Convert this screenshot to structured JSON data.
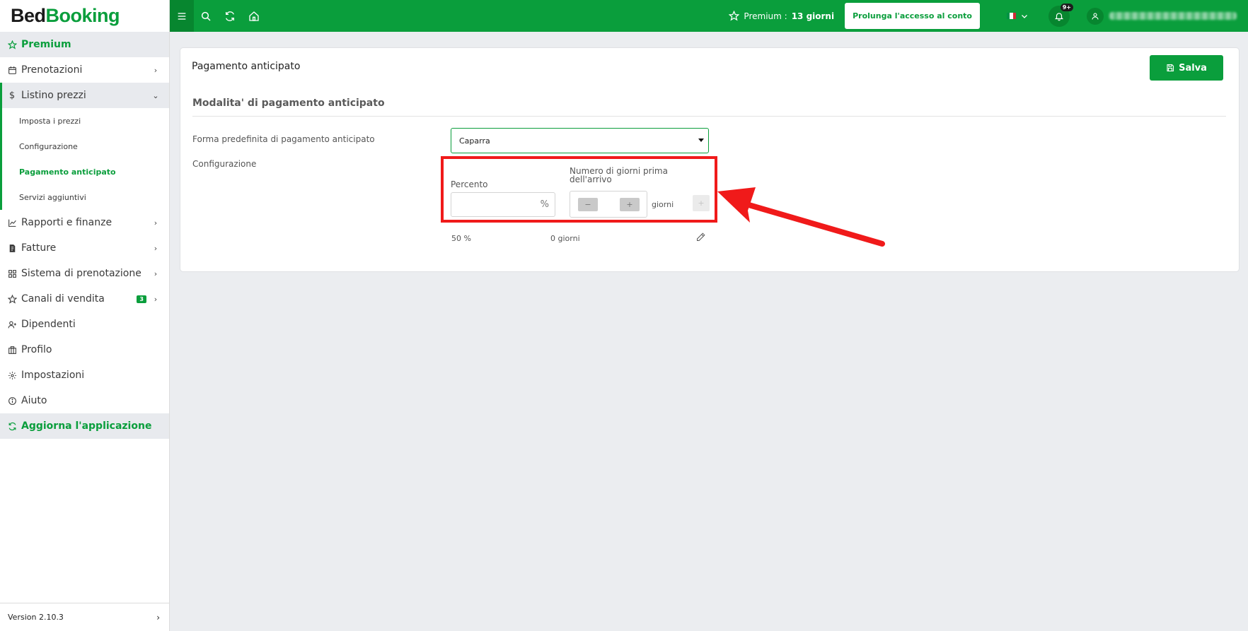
{
  "app": {
    "logo_part1": "Bed",
    "logo_part2": "Booking",
    "brand_color": "#0a9e3c"
  },
  "sidebar": {
    "premium": "Premium",
    "items": [
      {
        "label": "Prenotazioni"
      },
      {
        "label": "Listino prezzi"
      },
      {
        "label": "Rapporti e finanze"
      },
      {
        "label": "Fatture"
      },
      {
        "label": "Sistema di prenotazione"
      },
      {
        "label": "Canali di vendita",
        "badge": "3"
      },
      {
        "label": "Dipendenti"
      },
      {
        "label": "Profilo"
      },
      {
        "label": "Impostazioni"
      },
      {
        "label": "Aiuto"
      }
    ],
    "subitems": [
      {
        "label": "Imposta i prezzi"
      },
      {
        "label": "Configurazione"
      },
      {
        "label": "Pagamento anticipato"
      },
      {
        "label": "Servizi aggiuntivi"
      }
    ],
    "update": "Aggiorna l'applicazione",
    "version": "Version 2.10.3"
  },
  "topbar": {
    "premium_label": "Premium :",
    "premium_days": "13 giorni",
    "extend_button": "Prolunga l'accesso al conto",
    "notifications_badge": "9+"
  },
  "page": {
    "title": "Pagamento anticipato",
    "save_button": "Salva",
    "section_title": "Modalita' di pagamento anticipato",
    "default_form_label": "Forma predefinita di pagamento anticipato",
    "default_form_value": "Caparra",
    "config_label": "Configurazione",
    "percent_label": "Percento",
    "percent_value": "",
    "percent_suffix": "%",
    "days_label_line1": "Numero di giorni prima",
    "days_label_line2": "dell'arrivo",
    "minus": "−",
    "plus": "+",
    "days_unit": "giorni",
    "add": "+",
    "rows": [
      {
        "percent": "50 %",
        "days": "0 giorni"
      }
    ]
  }
}
